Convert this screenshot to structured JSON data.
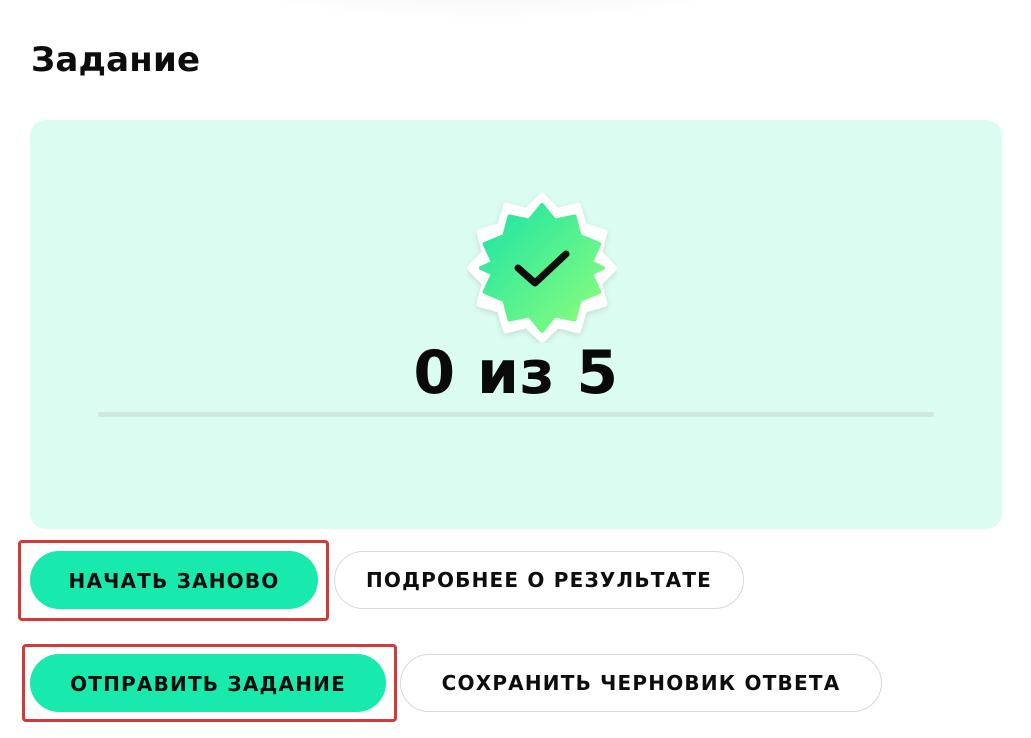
{
  "page": {
    "title": "Задание"
  },
  "result": {
    "score_text": "0 из 5",
    "score_value": 0,
    "score_max": 5,
    "progress_fraction": 0,
    "badge_icon": "check-badge-icon"
  },
  "actions": {
    "restart_label": "НАЧАТЬ ЗАНОВО",
    "details_label": "ПОДРОБНЕЕ О РЕЗУЛЬТАТЕ",
    "submit_label": "ОТПРАВИТЬ ЗАДАНИЕ",
    "save_draft_label": "СОХРАНИТЬ ЧЕРНОВИК ОТВЕТА"
  },
  "colors": {
    "card_background": "#dbfcf0",
    "primary_button": "#18e9ad",
    "highlight": "#d23a3a",
    "badge_gradient_start": "#19e3a6",
    "badge_gradient_end": "#8fff7a"
  }
}
